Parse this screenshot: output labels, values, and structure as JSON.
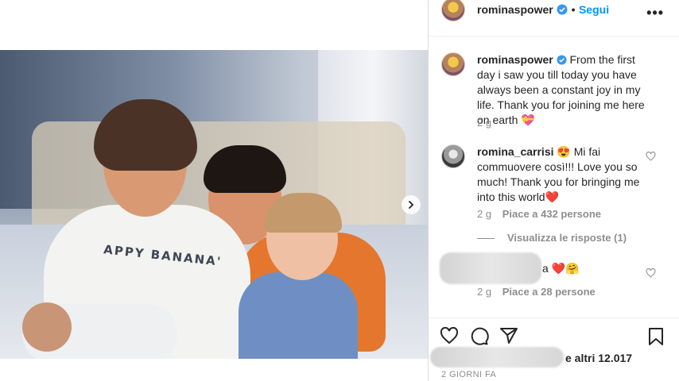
{
  "post": {
    "author": "rominaspower",
    "follow_label": "Segui",
    "header_separator": "•",
    "more_label": "•••",
    "image_shirt_text": "APPY BANANA'",
    "caption": {
      "username": "rominaspower",
      "text": "From the first day i saw you till today you have always been a constant joy in my life. Thank you for joining me here on earth 💝",
      "time": "2 g"
    },
    "comments": [
      {
        "username": "romina_carrisi",
        "text": "😍 Mi fai commuovere così!!! Love you so much! Thank you for bringing me into this world❤️",
        "time": "2 g",
        "likes": "Piace a 432 persone",
        "view_replies": "Visualizza le risposte (1)"
      },
      {
        "username": "",
        "text": "a ❤️🤗",
        "time": "2 g",
        "likes": "Piace a 28 persone"
      }
    ],
    "likes_suffix": "e altri 12.017",
    "timestamp": "2 GIORNI FA"
  },
  "colors": {
    "link": "#0095f6",
    "verified": "#3897f0",
    "muted": "#8e8e8e"
  },
  "icons": [
    "chevron-right-icon",
    "verified-icon",
    "more-icon",
    "heart-icon",
    "comment-icon",
    "share-icon",
    "bookmark-icon"
  ]
}
